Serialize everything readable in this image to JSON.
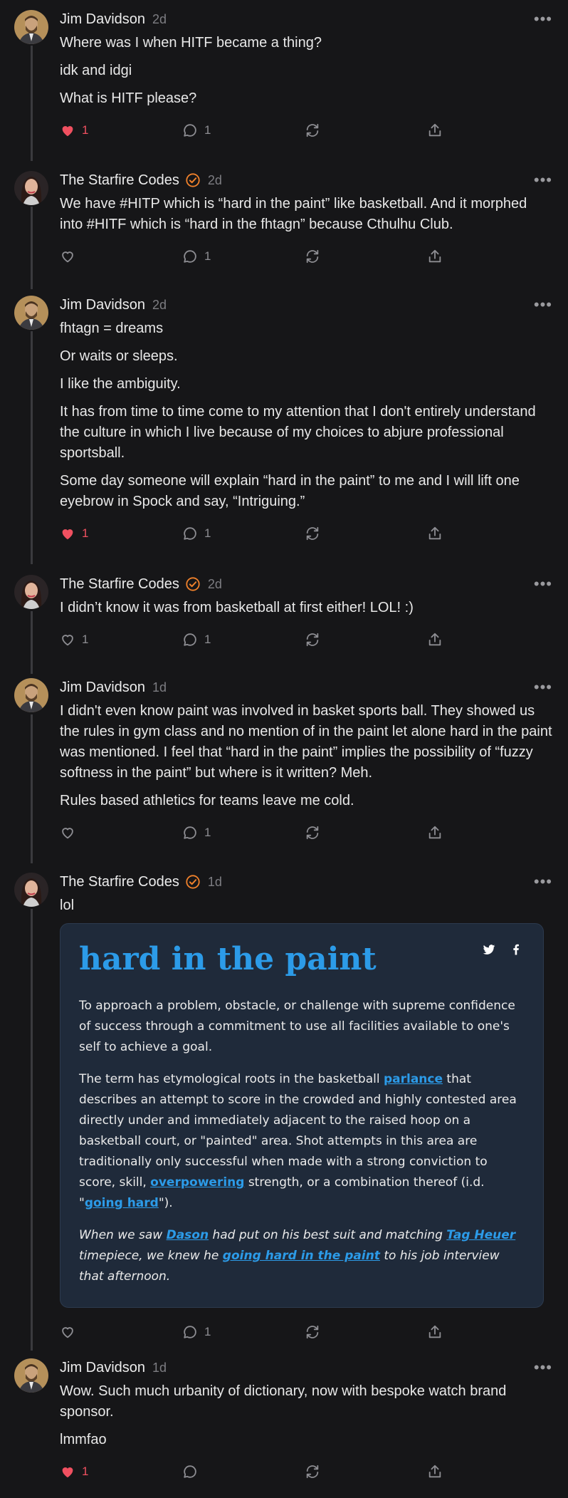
{
  "colors": {
    "bg": "#161618",
    "liked": "#f05060",
    "verified": "#f0812b",
    "link": "#2c9be8",
    "muted": "#8d8d92"
  },
  "icons": {
    "like": "heart-icon",
    "reply": "speech-bubble-icon",
    "repost": "repost-icon",
    "share": "share-icon",
    "more": "ellipsis-icon",
    "verified": "verified-badge-icon",
    "twitter": "twitter-icon",
    "facebook": "facebook-icon"
  },
  "posts": [
    {
      "author": "Jim Davidson",
      "time": "2d",
      "verified": false,
      "paragraphs": [
        "Where was I when HITF became a thing?",
        "idk and idgi",
        "What is HITF please?"
      ],
      "likes": "1",
      "liked": true,
      "replies": "1"
    },
    {
      "author": "The Starfire Codes",
      "time": "2d",
      "verified": true,
      "paragraphs": [
        "We have #HITP which is “hard in the paint” like basketball. And it morphed into #HITF which is “hard in the fhtagn” because Cthulhu Club."
      ],
      "likes": "",
      "liked": false,
      "replies": "1"
    },
    {
      "author": "Jim Davidson",
      "time": "2d",
      "verified": false,
      "paragraphs": [
        "fhtagn = dreams",
        "Or waits or sleeps.",
        "I like the ambiguity.",
        "It has from time to time come to my attention that I don't entirely understand the culture in which I live because of my choices to abjure professional sportsball.",
        "Some day someone will explain “hard in the paint” to me and I will lift one eyebrow in Spock and say, “Intriguing.”"
      ],
      "likes": "1",
      "liked": true,
      "replies": "1"
    },
    {
      "author": "The Starfire Codes",
      "time": "2d",
      "verified": true,
      "paragraphs": [
        "I didn’t know it was from basketball at first either! LOL! :)"
      ],
      "likes": "1",
      "liked": false,
      "replies": "1"
    },
    {
      "author": "Jim Davidson",
      "time": "1d",
      "verified": false,
      "paragraphs": [
        "I didn't even know paint was involved in basket sports ball. They showed us the rules in gym class and no mention of in the paint let alone hard in the paint was mentioned. I feel that “hard in the paint” implies the possibility of “fuzzy softness in the paint” but where is it written? Meh.",
        "Rules based athletics for teams leave me cold."
      ],
      "likes": "",
      "liked": false,
      "replies": "1"
    },
    {
      "author": "The Starfire Codes",
      "time": "1d",
      "verified": true,
      "paragraphs": [
        "lol"
      ],
      "likes": "",
      "liked": false,
      "replies": "1"
    },
    {
      "author": "Jim Davidson",
      "time": "1d",
      "verified": false,
      "paragraphs": [
        "Wow. Such much urbanity of dictionary, now with bespoke watch brand sponsor.",
        "lmmfao"
      ],
      "likes": "1",
      "liked": true,
      "replies": ""
    }
  ],
  "card": {
    "title": "hard in the paint",
    "definition": "To approach a problem, obstacle, or challenge with supreme confidence of success through a commitment to use all facilities available to one's self to achieve a goal.",
    "etym_1": "The term has etymological roots in the basketball ",
    "link_parlance": "parlance",
    "etym_2": " that describes an attempt to score in the crowded and highly contested area directly under and immediately adjacent to the raised hoop on a basketball court, or \"painted\" area. Shot attempts in this area are traditionally only successful when made with a strong conviction to score, skill, ",
    "link_overpowering": "overpowering",
    "etym_3": " strength, or a combination thereof (i.d. \"",
    "link_going_hard": "going hard",
    "etym_4": "\").",
    "ex_1": "When we saw ",
    "link_dason": "Dason",
    "ex_2": " had put on his best suit and matching ",
    "link_tag_heuer": "Tag Heuer",
    "ex_3": " timepiece, we knew he ",
    "link_going_hard_paint": "going hard in the paint",
    "ex_4": " to his job interview that afternoon."
  }
}
